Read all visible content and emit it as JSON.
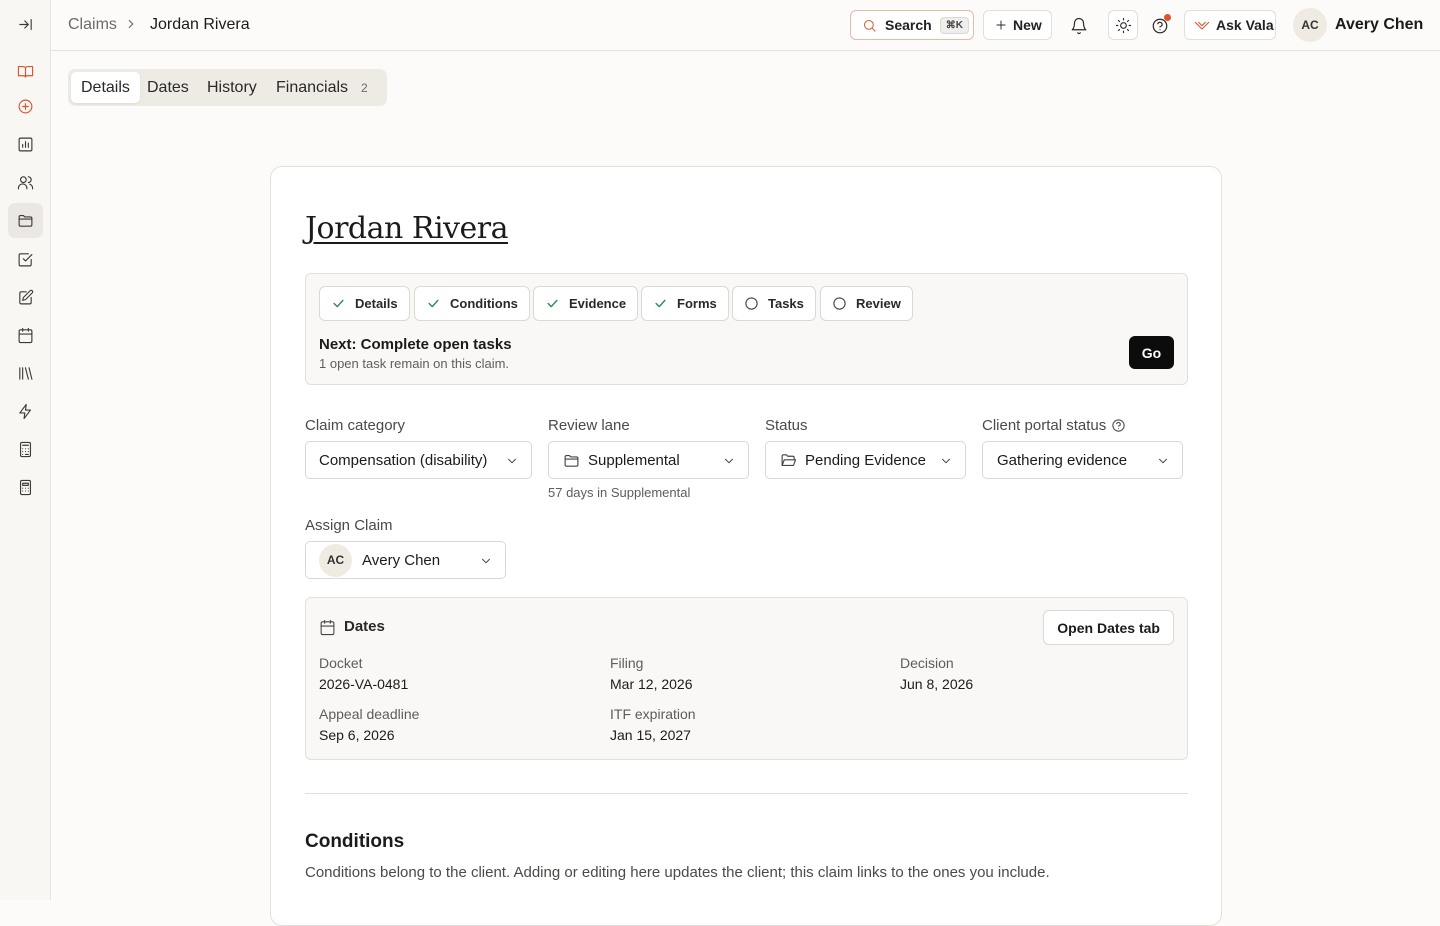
{
  "sidebar": {
    "items": [
      {
        "icon": "collapse-sidebar-icon"
      },
      {
        "icon": "book-icon",
        "accent": "#d9552b"
      },
      {
        "icon": "plus-circle-icon",
        "accent": "#d9552b"
      },
      {
        "icon": "chart-icon"
      },
      {
        "icon": "users-icon"
      },
      {
        "icon": "folder-icon",
        "active": true
      },
      {
        "icon": "checkbox-icon"
      },
      {
        "icon": "edit-form-icon"
      },
      {
        "icon": "calendar-icon"
      },
      {
        "icon": "library-icon"
      },
      {
        "icon": "lightning-icon"
      },
      {
        "icon": "calculator-icon"
      },
      {
        "icon": "calculator-alt-icon"
      }
    ]
  },
  "header": {
    "breadcrumb_root": "Claims",
    "breadcrumb_current": "Jordan Rivera",
    "search_label": "Search",
    "search_shortcut": "⌘K",
    "new_label": "New",
    "ask_label": "Ask Vala",
    "user_initials": "AC",
    "user_name": "Avery Chen",
    "accent_color": "#d9552b"
  },
  "tabs": [
    {
      "label": "Details",
      "active": true
    },
    {
      "label": "Dates"
    },
    {
      "label": "History"
    },
    {
      "label": "Financials",
      "count": "2"
    }
  ],
  "claim": {
    "client_name": "Jordan Rivera",
    "steps": [
      {
        "label": "Details",
        "state": "done"
      },
      {
        "label": "Conditions",
        "state": "done"
      },
      {
        "label": "Evidence",
        "state": "done"
      },
      {
        "label": "Forms",
        "state": "done"
      },
      {
        "label": "Tasks",
        "state": "open"
      },
      {
        "label": "Review",
        "state": "open"
      }
    ],
    "next_title": "Next: Complete open tasks",
    "next_desc": "1 open task remain on this claim.",
    "go_label": "Go",
    "fields": {
      "category_label": "Claim category",
      "category_value": "Compensation (disability)",
      "lane_label": "Review lane",
      "lane_value": "Supplemental",
      "lane_note": "57 days in Supplemental",
      "status_label": "Status",
      "status_value": "Pending Evidence",
      "portal_label": "Client portal status",
      "portal_value": "Gathering evidence",
      "assign_label": "Assign Claim",
      "assign_initials": "AC",
      "assign_value": "Avery Chen"
    },
    "dates": {
      "title": "Dates",
      "open_tab_label": "Open Dates tab",
      "docket_label": "Docket",
      "docket_value": "2026-VA-0481",
      "filing_label": "Filing",
      "filing_value": "Mar 12, 2026",
      "decision_label": "Decision",
      "decision_value": "Jun 8, 2026",
      "appeal_label": "Appeal deadline",
      "appeal_value": "Sep 6, 2026",
      "itf_label": "ITF expiration",
      "itf_value": "Jan 15, 2027"
    },
    "conditions": {
      "title": "Conditions",
      "desc": "Conditions belong to the client. Adding or editing here updates the client; this claim links to the ones you include."
    }
  }
}
